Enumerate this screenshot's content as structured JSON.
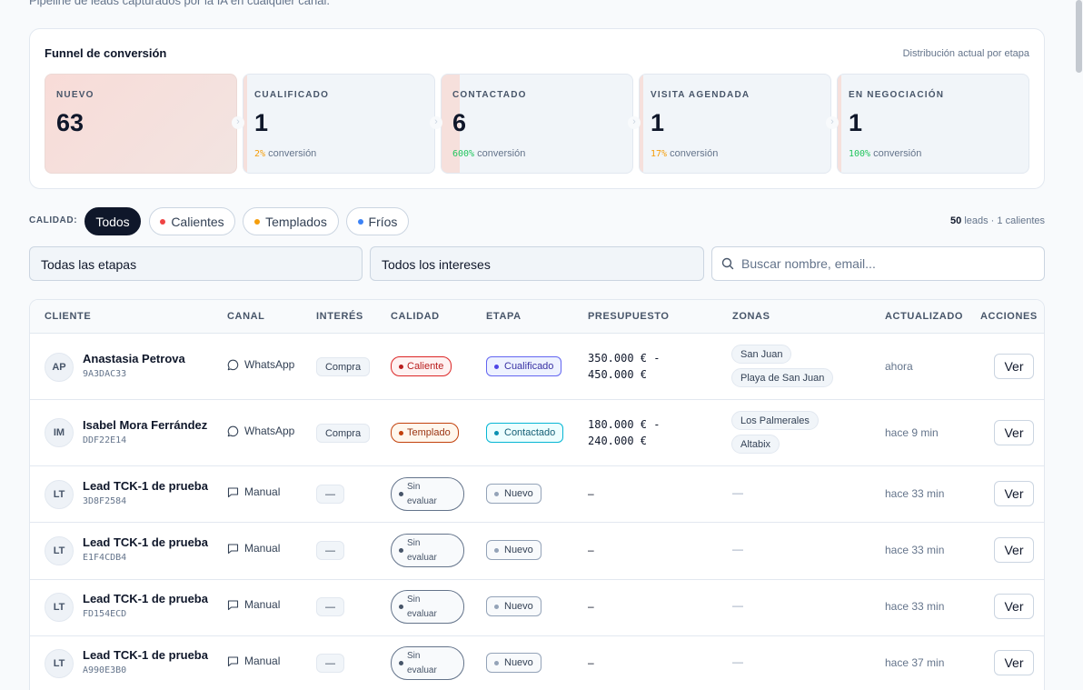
{
  "header": {
    "subtitle": "Pipeline de leads capturados por la IA en cualquier canal."
  },
  "funnel": {
    "title": "Funnel de conversión",
    "hint": "Distribución actual por etapa",
    "conversion_suffix": "conversión",
    "stages": [
      {
        "label": "NUEVO",
        "count": "63",
        "conversion_pct": "",
        "pct_color": ""
      },
      {
        "label": "CUALIFICADO",
        "count": "1",
        "conversion_pct": "2%",
        "pct_color": "#f59e0b"
      },
      {
        "label": "CONTACTADO",
        "count": "6",
        "conversion_pct": "600%",
        "pct_color": "#22c55e"
      },
      {
        "label": "VISITA AGENDADA",
        "count": "1",
        "conversion_pct": "17%",
        "pct_color": "#f59e0b"
      },
      {
        "label": "EN NEGOCIACIÓN",
        "count": "1",
        "conversion_pct": "100%",
        "pct_color": "#22c55e"
      }
    ]
  },
  "filters": {
    "calidad_label": "CALIDAD:",
    "pills": [
      {
        "label": "Todos",
        "dot_color": "",
        "active": true
      },
      {
        "label": "Calientes",
        "dot_color": "#ef4444",
        "active": false
      },
      {
        "label": "Templados",
        "dot_color": "#f59e0b",
        "active": false
      },
      {
        "label": "Fríos",
        "dot_color": "#3b82f6",
        "active": false
      }
    ],
    "leads_total": "50",
    "leads_suffix": "leads · 1 calientes",
    "stage_select": "Todas las etapas",
    "interest_select": "Todos los intereses",
    "search_placeholder": "Buscar nombre, email..."
  },
  "table": {
    "headers": [
      "CLIENTE",
      "CANAL",
      "INTERÉS",
      "CALIDAD",
      "ETAPA",
      "PRESUPUESTO",
      "ZONAS",
      "ACTUALIZADO",
      "ACCIONES"
    ],
    "view_label": "Ver",
    "rows": [
      {
        "initials": "AP",
        "name": "Anastasia Petrova",
        "code": "9A3DAC33",
        "canal": "WhatsApp",
        "interes": "Compra",
        "calidad": "Caliente",
        "etapa": "Cualificado",
        "presupuesto_1": "350.000 € -",
        "presupuesto_2": "450.000 €",
        "zonas": [
          "San Juan",
          "Playa de San Juan"
        ],
        "actualizado": "ahora"
      },
      {
        "initials": "IM",
        "name": "Isabel Mora Ferrández",
        "code": "DDF22E14",
        "canal": "WhatsApp",
        "interes": "Compra",
        "calidad": "Templado",
        "etapa": "Contactado",
        "presupuesto_1": "180.000 € -",
        "presupuesto_2": "240.000 €",
        "zonas": [
          "Los Palmerales",
          "Altabix"
        ],
        "actualizado": "hace 9 min"
      },
      {
        "initials": "LT",
        "name": "Lead TCK-1 de prueba",
        "code": "3D8F2584",
        "canal": "Manual",
        "interes": "—",
        "calidad_1": "Sin",
        "calidad_2": "evaluar",
        "etapa": "Nuevo",
        "presupuesto_1": "–",
        "zona_dash": "—",
        "actualizado": "hace 33 min"
      },
      {
        "initials": "LT",
        "name": "Lead TCK-1 de prueba",
        "code": "E1F4CDB4",
        "canal": "Manual",
        "interes": "—",
        "calidad_1": "Sin",
        "calidad_2": "evaluar",
        "etapa": "Nuevo",
        "presupuesto_1": "–",
        "zona_dash": "—",
        "actualizado": "hace 33 min"
      },
      {
        "initials": "LT",
        "name": "Lead TCK-1 de prueba",
        "code": "FD154ECD",
        "canal": "Manual",
        "interes": "—",
        "calidad_1": "Sin",
        "calidad_2": "evaluar",
        "etapa": "Nuevo",
        "presupuesto_1": "–",
        "zona_dash": "—",
        "actualizado": "hace 33 min"
      },
      {
        "initials": "LT",
        "name": "Lead TCK-1 de prueba",
        "code": "A990E3B0",
        "canal": "Manual",
        "interes": "—",
        "calidad_1": "Sin",
        "calidad_2": "evaluar",
        "etapa": "Nuevo",
        "presupuesto_1": "–",
        "zona_dash": "—",
        "actualizado": "hace 37 min"
      }
    ]
  }
}
